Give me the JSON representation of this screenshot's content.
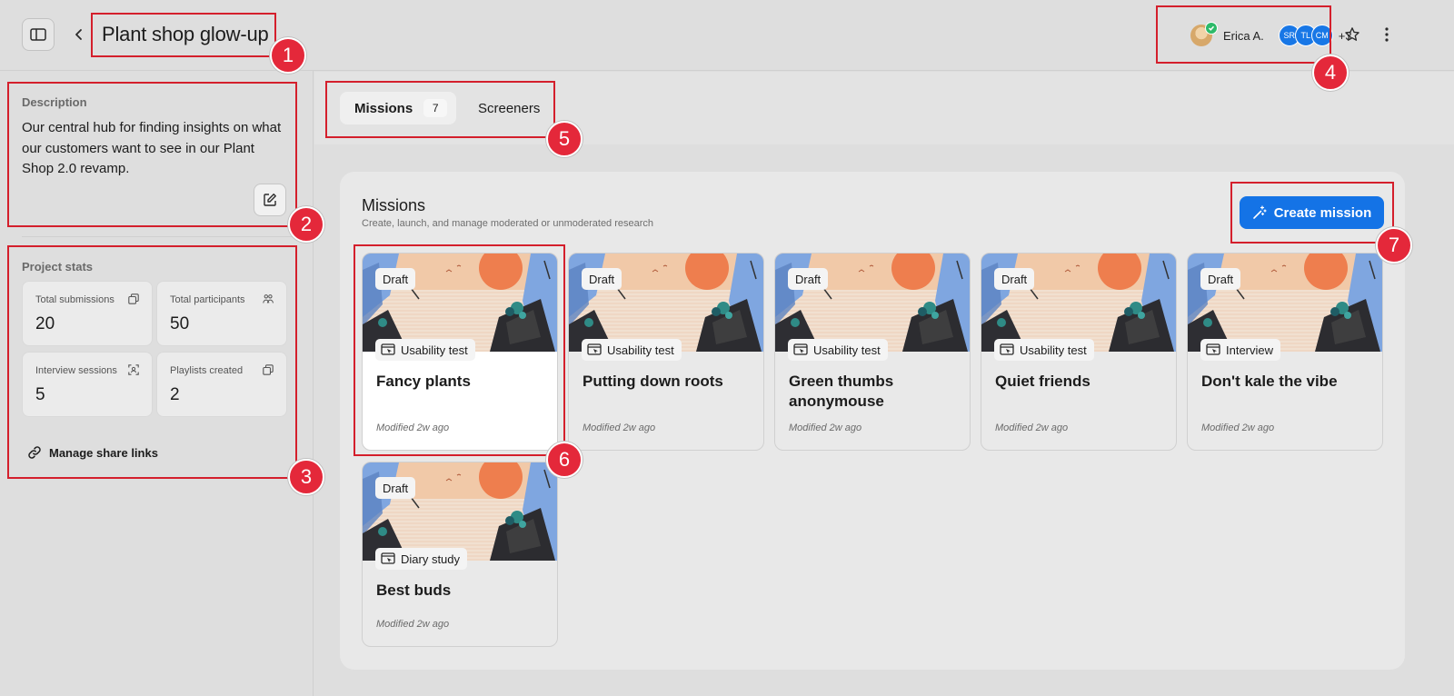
{
  "header": {
    "title": "Plant shop glow-up",
    "collaborators": {
      "primary_name": "Erica A.",
      "initials": [
        "SR",
        "TL",
        "CM"
      ],
      "more_count": "+3"
    }
  },
  "description": {
    "label": "Description",
    "text": "Our central hub for finding insights on what our customers want to see in our Plant Shop 2.0 revamp."
  },
  "project_stats": {
    "label": "Project stats",
    "items": [
      {
        "label": "Total submissions",
        "value": "20",
        "icon": "copy-icon"
      },
      {
        "label": "Total participants",
        "value": "50",
        "icon": "people-icon"
      },
      {
        "label": "Interview sessions",
        "value": "5",
        "icon": "scan-face-icon"
      },
      {
        "label": "Playlists created",
        "value": "2",
        "icon": "copy-icon"
      }
    ],
    "share_label": "Manage share links"
  },
  "tabs": [
    {
      "label": "Missions",
      "count": "7",
      "active": true
    },
    {
      "label": "Screeners",
      "active": false
    }
  ],
  "missions": {
    "title": "Missions",
    "subtitle": "Create, launch, and manage moderated or unmoderated research",
    "create_label": "Create mission",
    "cards": [
      {
        "status": "Draft",
        "type": "Usability test",
        "title": "Fancy plants",
        "modified": "Modified 2w ago"
      },
      {
        "status": "Draft",
        "type": "Usability test",
        "title": "Putting down roots",
        "modified": "Modified 2w ago"
      },
      {
        "status": "Draft",
        "type": "Usability test",
        "title": "Green thumbs anonymouse",
        "modified": "Modified 2w ago"
      },
      {
        "status": "Draft",
        "type": "Usability test",
        "title": "Quiet friends",
        "modified": "Modified 2w ago"
      },
      {
        "status": "Draft",
        "type": "Interview",
        "title": "Don't kale the vibe",
        "modified": "Modified 2w ago"
      },
      {
        "status": "Draft",
        "type": "Diary study",
        "title": "Best buds",
        "modified": "Modified 2w ago"
      }
    ]
  },
  "annotations": [
    "1",
    "2",
    "3",
    "4",
    "5",
    "6",
    "7"
  ],
  "colors": {
    "accent": "#1473e6",
    "annotation": "#e4283a",
    "avatar": "#1877e6",
    "verified": "#2dba6a"
  }
}
